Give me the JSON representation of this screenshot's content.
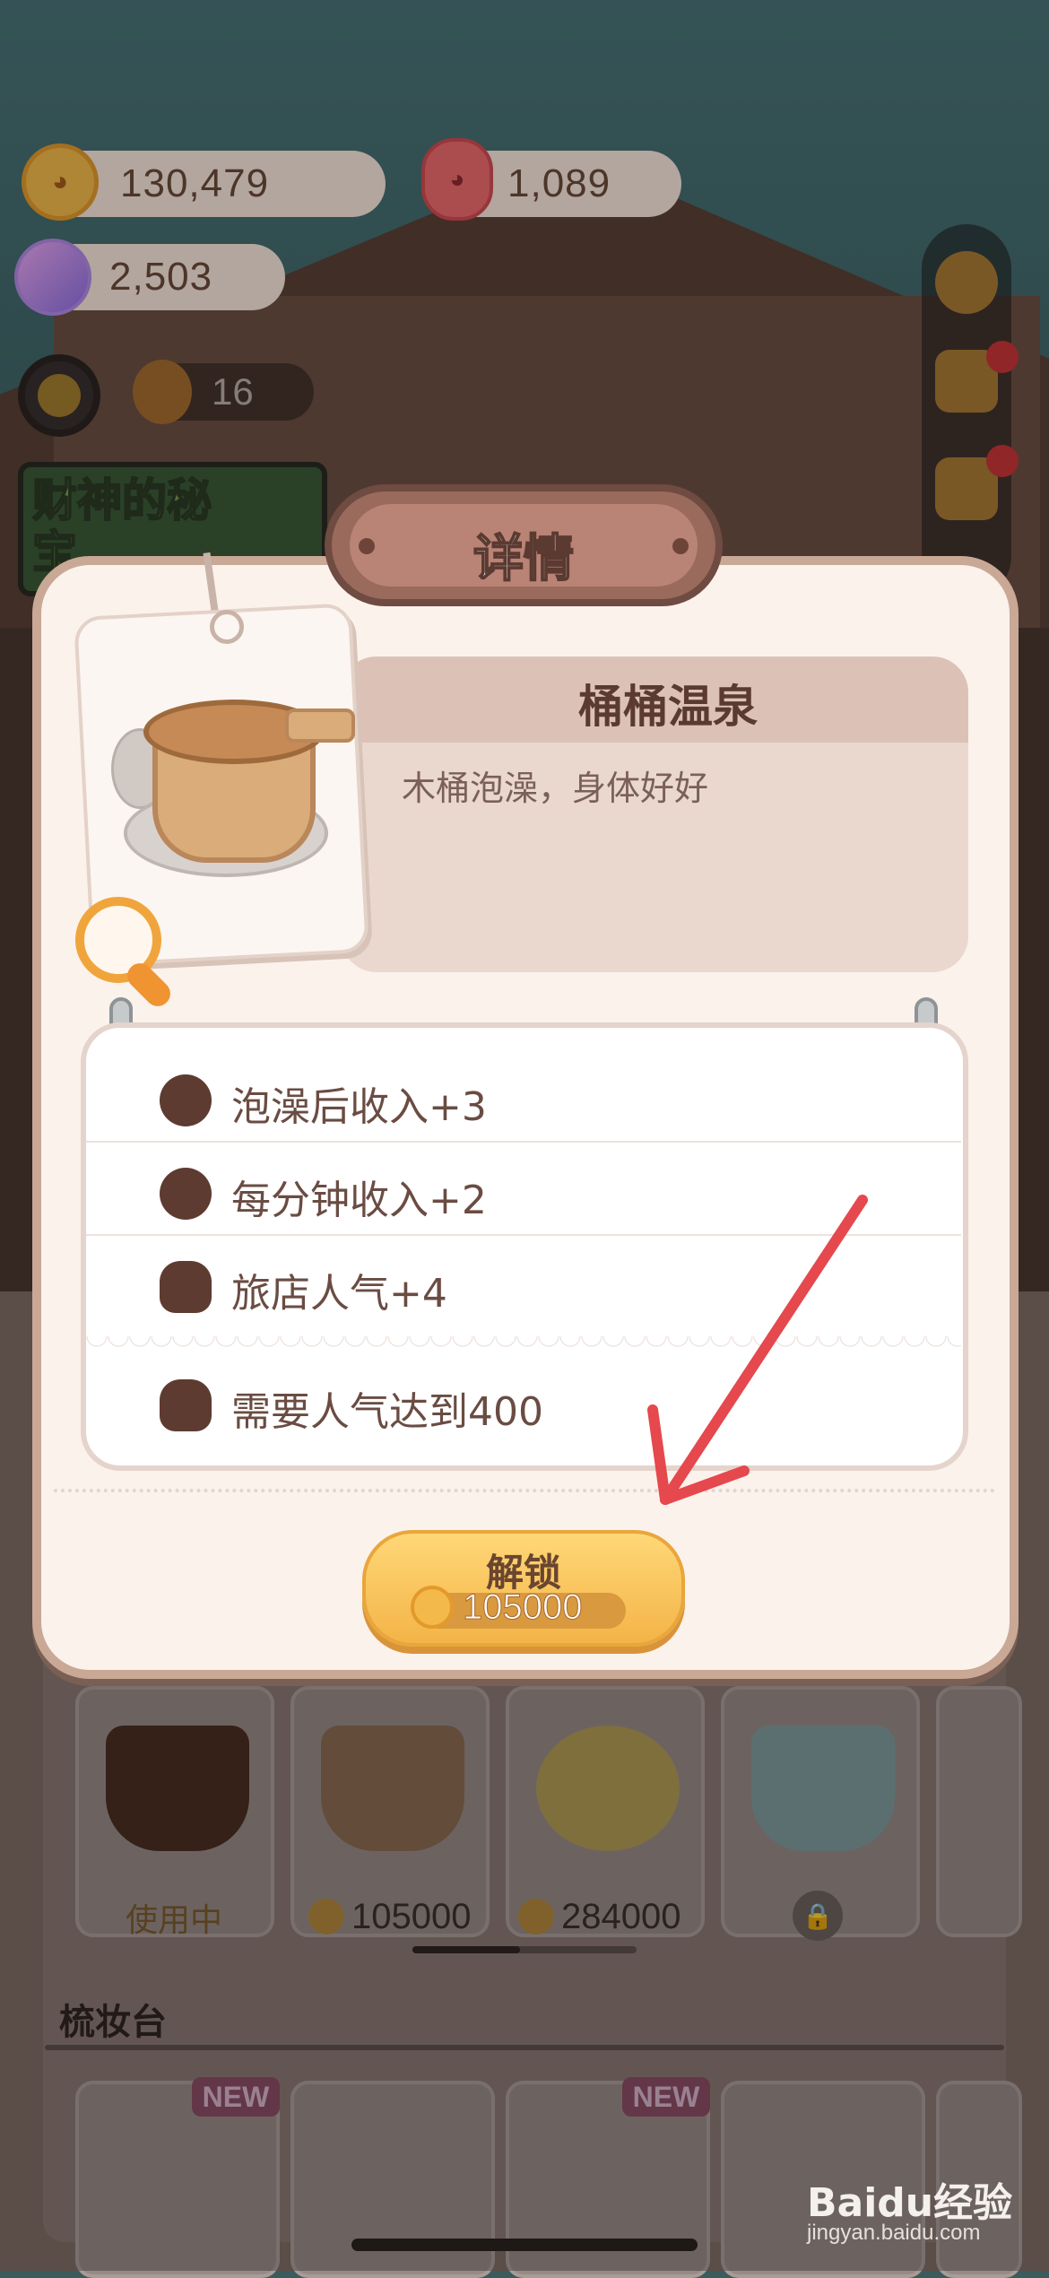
{
  "hud": {
    "coins": "130,479",
    "red_currency": "1,089",
    "gems": "2,503",
    "popularity": "16",
    "banner_text": "财神的秘宝"
  },
  "modal": {
    "title": "详情",
    "item_name": "桶桶温泉",
    "item_description": "木桶泡澡，身体好好",
    "stats": [
      {
        "icon": "cookie-icon",
        "text": "泡澡后收入+3"
      },
      {
        "icon": "cookie-icon",
        "text": "每分钟收入+2"
      },
      {
        "icon": "popularity-icon",
        "text": "旅店人气+4"
      }
    ],
    "requirement": {
      "icon": "popularity-icon",
      "text": "需要人气达到400"
    },
    "unlock_button": {
      "label": "解锁",
      "price": "105000"
    }
  },
  "shop": {
    "items": [
      {
        "status": "使用中"
      },
      {
        "price": "105000"
      },
      {
        "price": "284000"
      },
      {
        "locked": true
      }
    ],
    "section_title": "梳妆台",
    "new_tag": "NEW"
  },
  "watermark": {
    "brand": "Baidu经验",
    "url": "jingyan.baidu.com"
  },
  "colors": {
    "modal_bg": "#fbf2ec",
    "ribbon": "#9a6a5c",
    "button_gold": "#f3b448",
    "arrow": "#e5484d"
  }
}
